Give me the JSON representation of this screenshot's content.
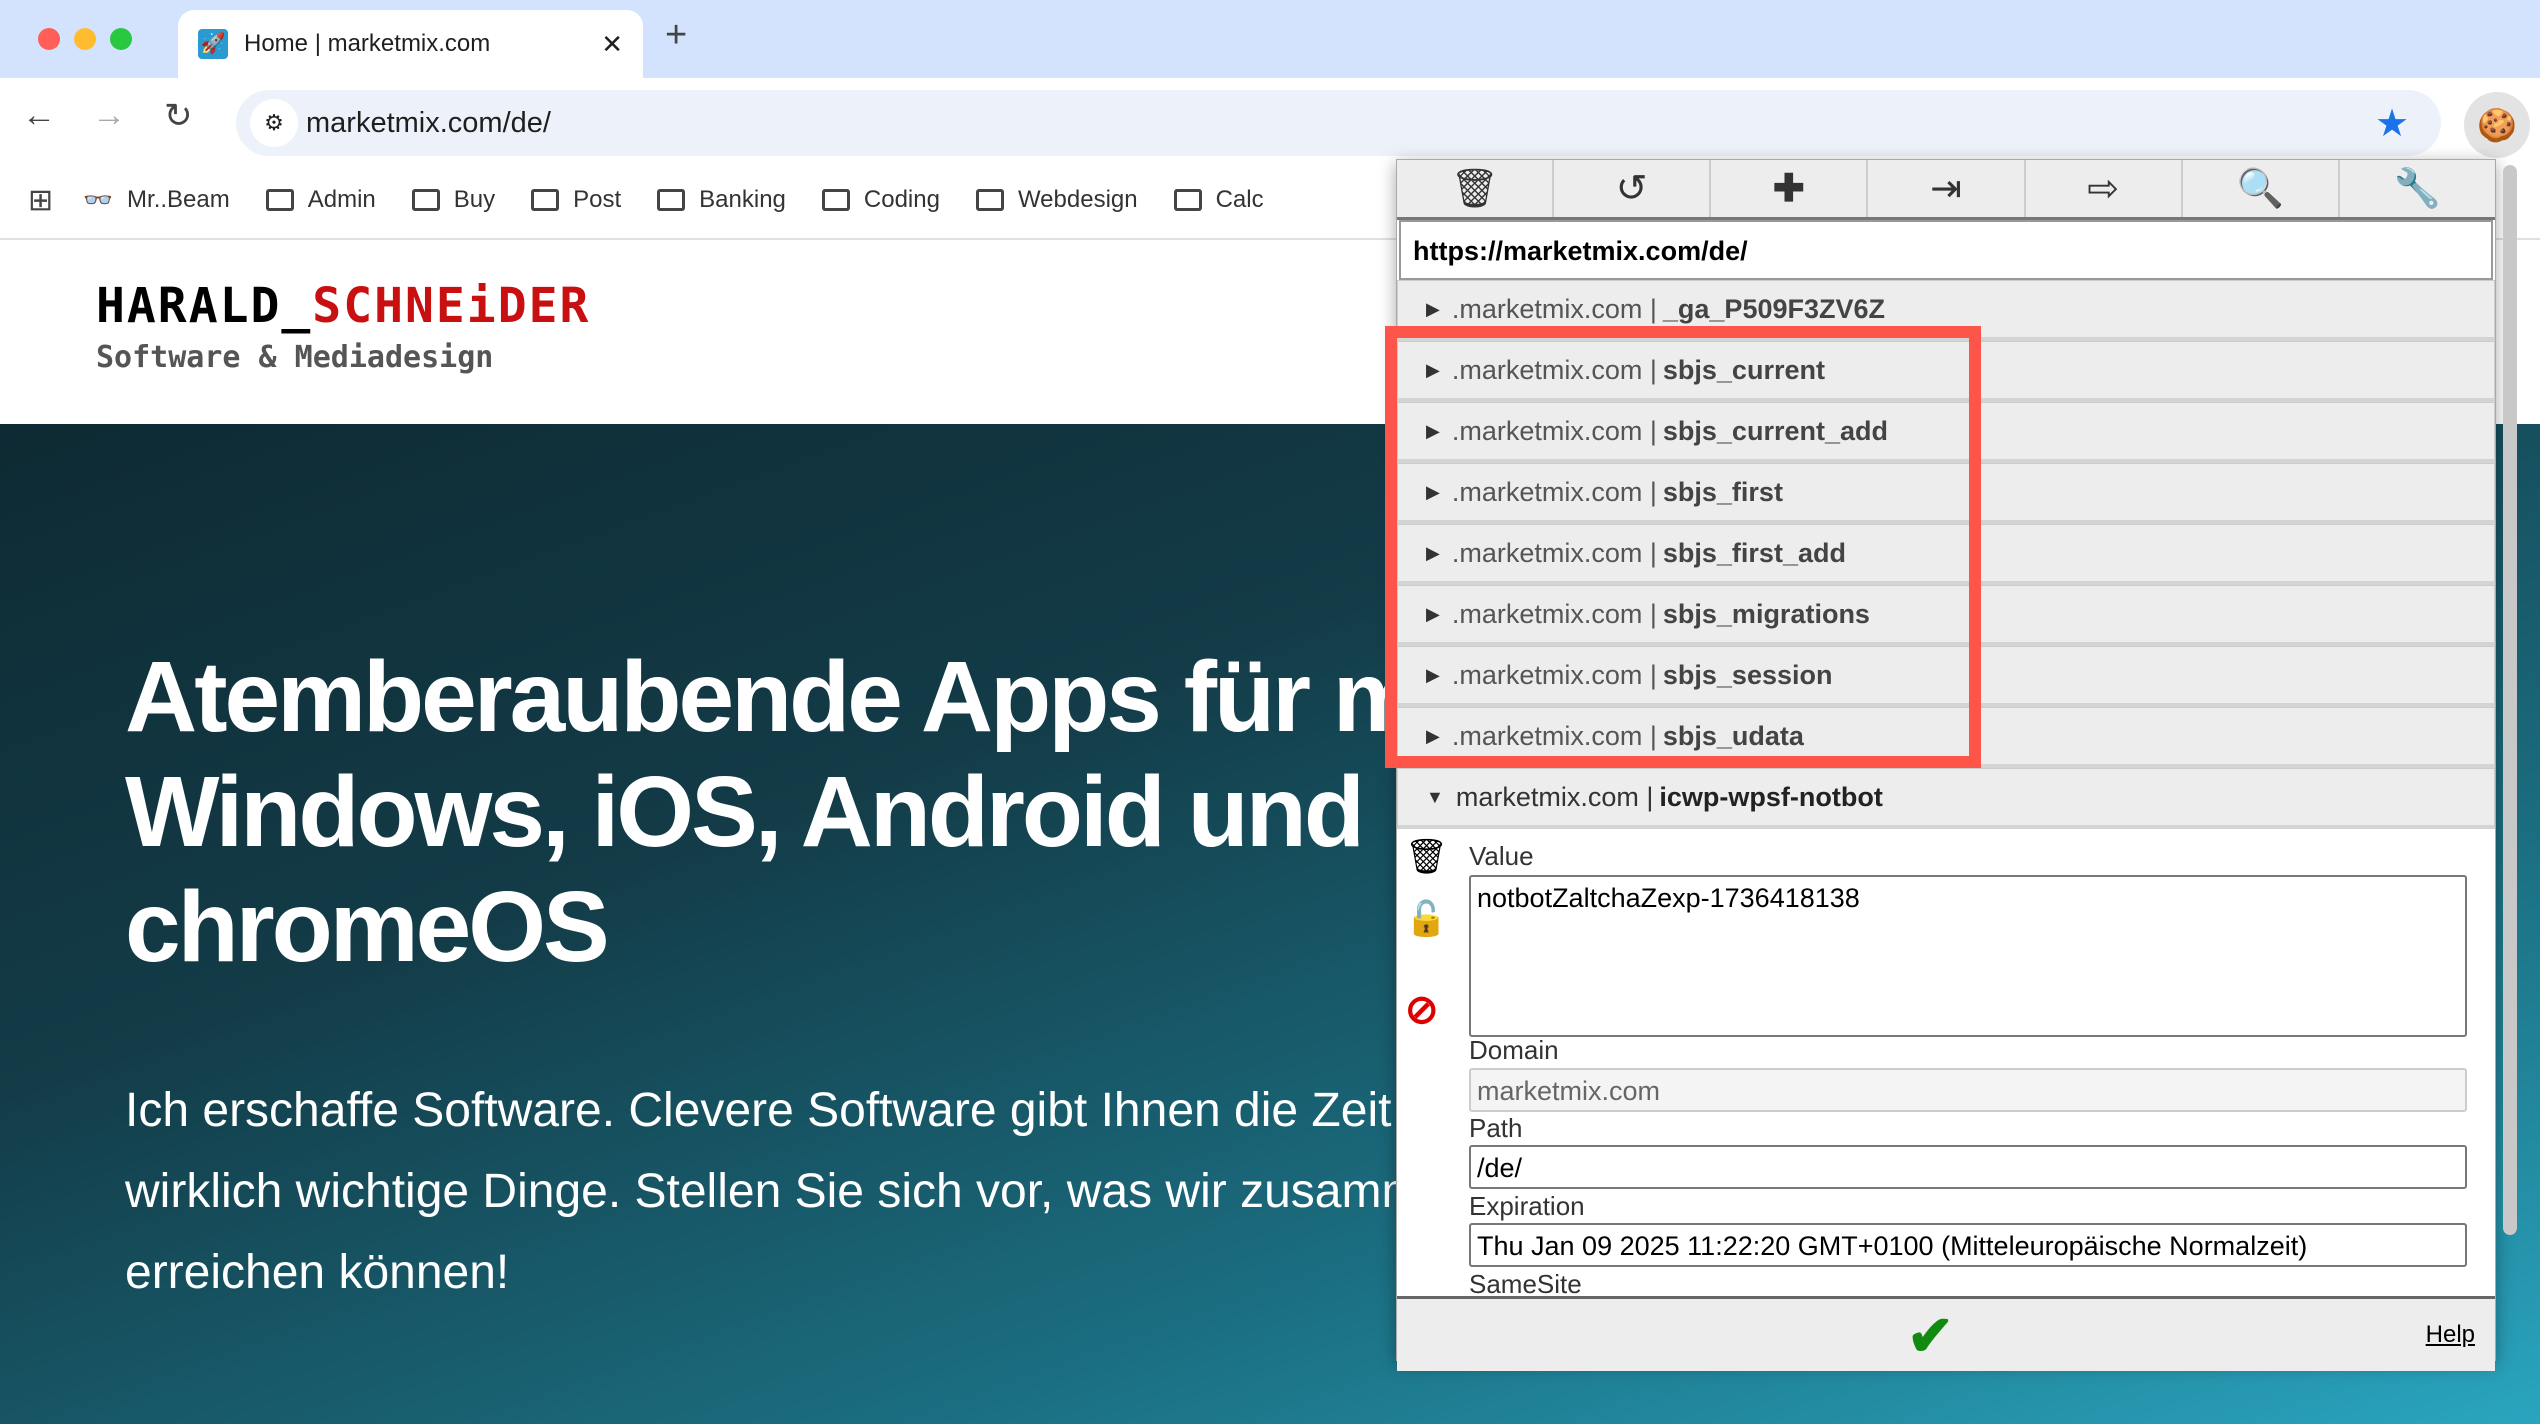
{
  "browser": {
    "tab_title": "Home | marketmix.com",
    "url": "marketmix.com/de/",
    "bookmarks": [
      "Mr..Beam",
      "Admin",
      "Buy",
      "Post",
      "Banking",
      "Coding",
      "Webdesign",
      "Calc"
    ]
  },
  "page": {
    "logo_name_black": "HARALD_",
    "logo_name_red": "SCHNEiDER",
    "logo_tagline": "Software & Mediadesign",
    "headline": [
      "Atemberaubende Apps für ma",
      "Windows, iOS, Android und",
      "chromeOS"
    ],
    "paragraph": [
      "Ich erschaffe Software. Clevere Software gibt Ihnen die Zeit",
      "wirklich wichtige Dinge. Stellen Sie sich vor, was wir zusamm",
      "erreichen können!"
    ]
  },
  "cookie_editor": {
    "url": "https://marketmix.com/de/",
    "cookies": [
      {
        "domain": ".marketmix.com",
        "name": "_ga_P509F3ZV6Z"
      },
      {
        "domain": ".marketmix.com",
        "name": "sbjs_current"
      },
      {
        "domain": ".marketmix.com",
        "name": "sbjs_current_add"
      },
      {
        "domain": ".marketmix.com",
        "name": "sbjs_first"
      },
      {
        "domain": ".marketmix.com",
        "name": "sbjs_first_add"
      },
      {
        "domain": ".marketmix.com",
        "name": "sbjs_migrations"
      },
      {
        "domain": ".marketmix.com",
        "name": "sbjs_session"
      },
      {
        "domain": ".marketmix.com",
        "name": "sbjs_udata"
      }
    ],
    "expanded": {
      "domain": "marketmix.com",
      "name": "icwp-wpsf-notbot",
      "value_label": "Value",
      "value": "notbotZaltchaZexp-1736418138",
      "domain_label": "Domain",
      "domain_value": "marketmix.com",
      "path_label": "Path",
      "path": "/de/",
      "expiration_label": "Expiration",
      "expiration": "Thu Jan 09 2025 11:22:20 GMT+0100 (Mitteleuropäische Normalzeit)",
      "samesite_label": "SameSite"
    },
    "help": "Help",
    "highlight_color": "#fd5549"
  }
}
